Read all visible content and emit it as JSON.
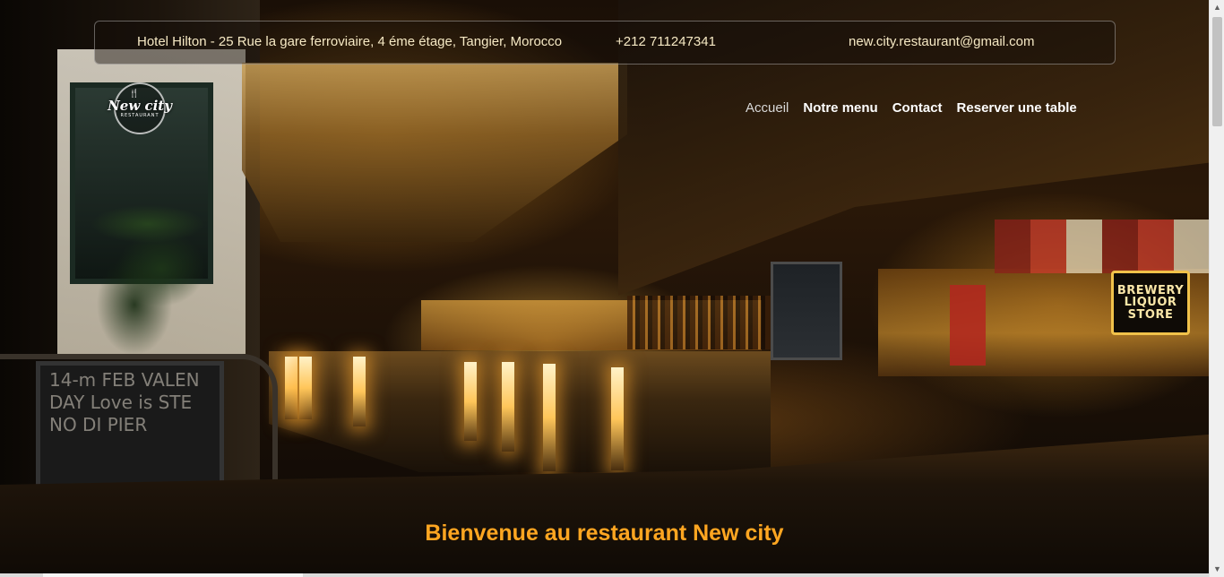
{
  "topbar": {
    "address": "Hotel Hilton - 25 Rue la gare ferroviaire, 4 éme étage, Tangier, Morocco",
    "phone": "+212 711247341",
    "email": "new.city.restaurant@gmail.com"
  },
  "logo": {
    "name": "New city",
    "sub": "RESTAURANT",
    "icon": "fork-knife-icon"
  },
  "nav": {
    "items": [
      {
        "label": "Accueil",
        "active": true
      },
      {
        "label": "Notre menu",
        "active": false
      },
      {
        "label": "Contact",
        "active": false
      },
      {
        "label": "Reserver une table",
        "active": false
      }
    ]
  },
  "hero": {
    "welcome": "Bienvenue au restaurant New city",
    "sign": "BREWERY LIQUOR STORE",
    "chalkboard": "14-m FEB VALEN DAY Love is STE NO DI PIER"
  },
  "colors": {
    "accent": "#ffa621",
    "topbar_text": "#f6e9c4",
    "nav_text": "#ffffff"
  }
}
